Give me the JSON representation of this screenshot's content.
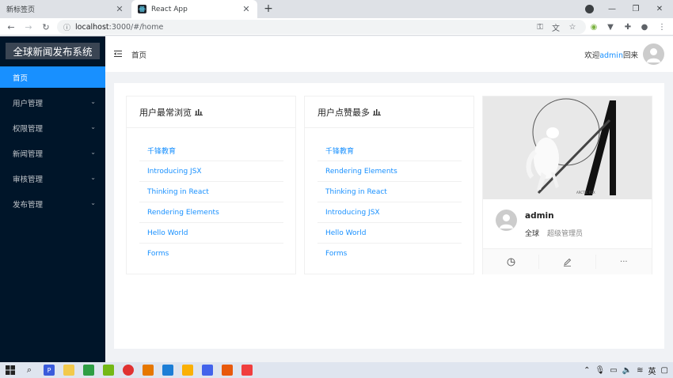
{
  "browser": {
    "tabs": [
      {
        "title": "新标签页",
        "active": false
      },
      {
        "title": "React App",
        "active": true
      }
    ],
    "url_host": "localhost",
    "url_rest": ":3000/#/home",
    "new_tab_glyph": "+",
    "close_glyph": "✕"
  },
  "sidebar": {
    "logo": "全球新闻发布系统",
    "items": [
      {
        "label": "首页",
        "selected": true,
        "has_children": false
      },
      {
        "label": "用户管理",
        "selected": false,
        "has_children": true
      },
      {
        "label": "权限管理",
        "selected": false,
        "has_children": true
      },
      {
        "label": "新闻管理",
        "selected": false,
        "has_children": true
      },
      {
        "label": "审核管理",
        "selected": false,
        "has_children": true
      },
      {
        "label": "发布管理",
        "selected": false,
        "has_children": true
      }
    ]
  },
  "header": {
    "breadcrumb": "首页",
    "welcome_prefix": "欢迎",
    "username": "admin",
    "welcome_suffix": "回来"
  },
  "cards": [
    {
      "title": "用户最常浏览",
      "items": [
        "千锋教育",
        "Introducing JSX",
        "Thinking in React",
        "Rendering Elements",
        "Hello World",
        "Forms"
      ]
    },
    {
      "title": "用户点赞最多",
      "items": [
        "千锋教育",
        "Rendering Elements",
        "Thinking in React",
        "Introducing JSX",
        "Hello World",
        "Forms"
      ]
    }
  ],
  "profile": {
    "name": "admin",
    "region": "全球",
    "role": "超级管理员",
    "cover_caption": "ARCTIC FOX"
  },
  "tray": {
    "lang": "英"
  },
  "colors": {
    "sider_bg": "#001529",
    "primary": "#1890ff",
    "logo_bg": "#3a4553"
  }
}
